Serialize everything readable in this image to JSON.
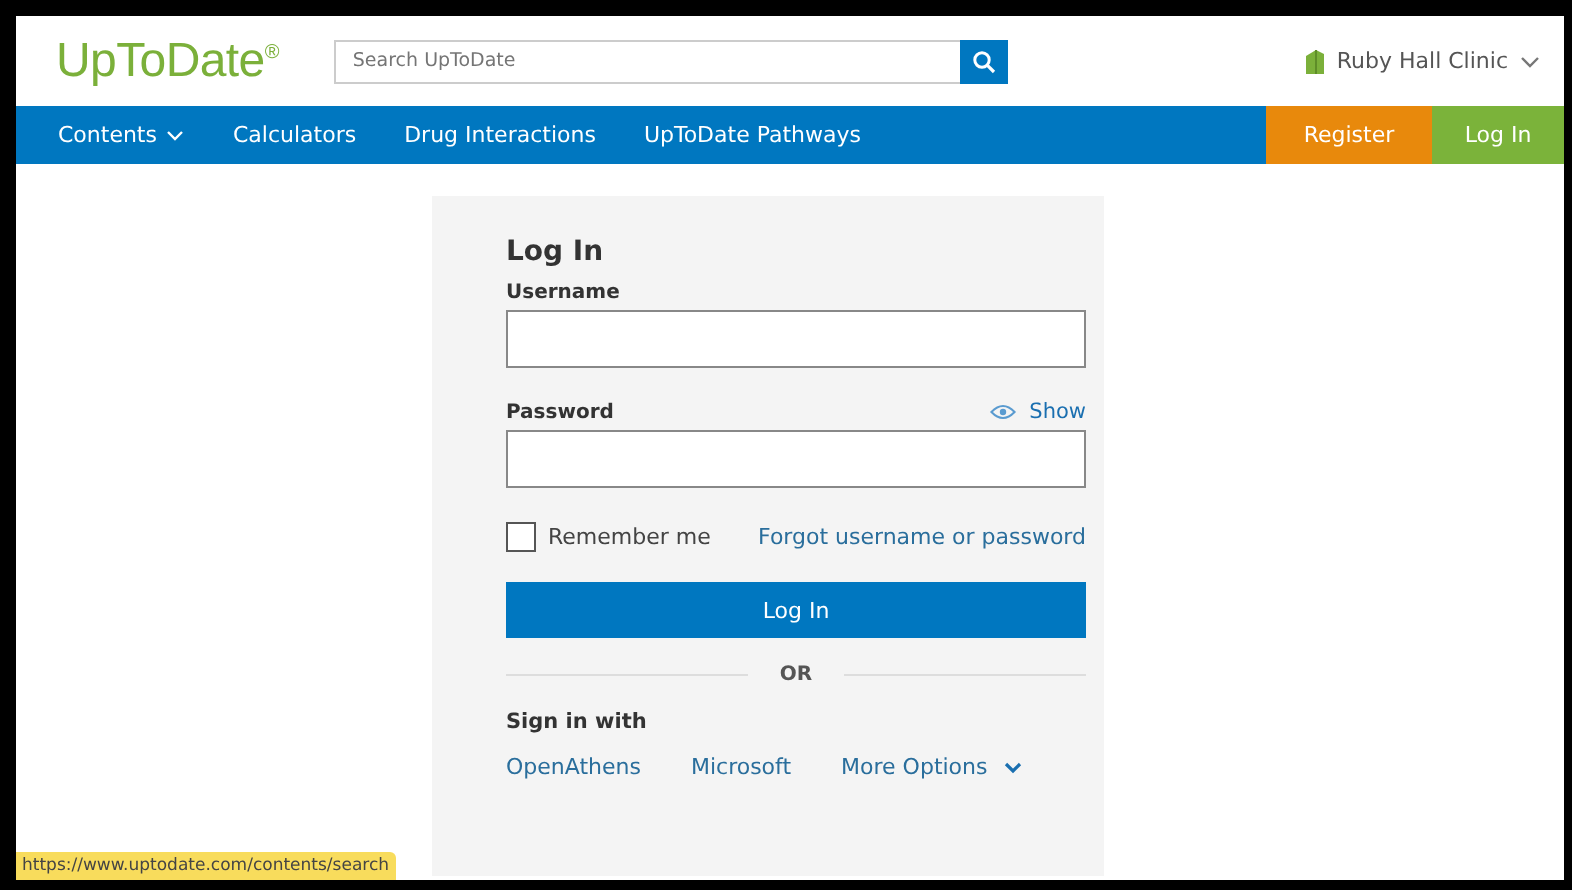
{
  "header": {
    "logo": "UpToDate",
    "logo_mark": "®",
    "search": {
      "placeholder": "Search UpToDate"
    },
    "institution": "Ruby Hall Clinic"
  },
  "nav": {
    "items": [
      {
        "label": "Contents",
        "dropdown": true
      },
      {
        "label": "Calculators",
        "dropdown": false
      },
      {
        "label": "Drug Interactions",
        "dropdown": false
      },
      {
        "label": "UpToDate Pathways",
        "dropdown": false
      }
    ],
    "register": "Register",
    "login": "Log In"
  },
  "login_form": {
    "title": "Log In",
    "username_label": "Username",
    "password_label": "Password",
    "show": "Show",
    "remember": {
      "label": "Remember me",
      "checked": false
    },
    "forgot": "Forgot username or password",
    "submit": "Log In",
    "or": "OR",
    "sign_in_with": "Sign in with",
    "providers": [
      {
        "label": "OpenAthens",
        "dropdown": false
      },
      {
        "label": "Microsoft",
        "dropdown": false
      },
      {
        "label": "More Options",
        "dropdown": true
      }
    ]
  },
  "status_bar": "https://www.uptodate.com/contents/search"
}
